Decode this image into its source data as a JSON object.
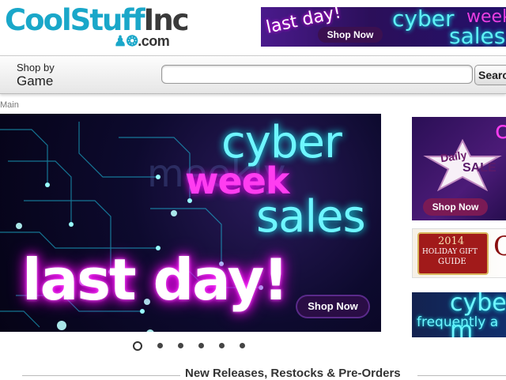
{
  "logo": {
    "main": "CoolStuff",
    "inc": "Inc",
    "sub": ".com"
  },
  "top_banner": {
    "last_day": "last day!",
    "shop_now": "Shop Now",
    "cyber": "cyber",
    "week": "week",
    "sales": "sales"
  },
  "nav": {
    "shop_by_line1": "Shop by",
    "shop_by_line2": "Game",
    "search_value": "",
    "search_button": "Search"
  },
  "breadcrumb": {
    "label": "Main"
  },
  "hero": {
    "cyber": "cyber",
    "week": "week",
    "sales": "sales",
    "last_day": "last day!",
    "shop_now": "Shop Now",
    "slide_count": 6,
    "active_slide": 1
  },
  "side": {
    "daily_sale": {
      "daily": "Daily",
      "sale": "SALE",
      "shop_now": "Shop Now"
    },
    "gift_guide": {
      "year": "2014",
      "title": "HOLIDAY GIFT",
      "guide": "GUIDE",
      "trail": "C"
    },
    "cyber_faq": {
      "cyber": "cyber m",
      "freq": "frequently  a"
    }
  },
  "section": {
    "title": "New Releases, Restocks & Pre-Orders"
  },
  "colors": {
    "brand_teal": "#1aa7c9",
    "neon_cyan": "#6ef6ff",
    "neon_magenta": "#ff3df0"
  }
}
